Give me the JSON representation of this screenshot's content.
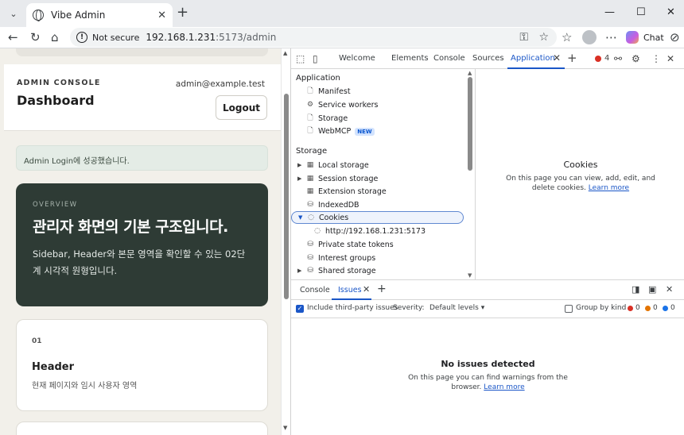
{
  "browser": {
    "tab_title": "Vibe Admin",
    "not_secure": "Not secure",
    "url_host": "192.168.1.231",
    "url_path": ":5173/admin",
    "chat_label": "Chat"
  },
  "page": {
    "kicker": "ADMIN CONSOLE",
    "title": "Dashboard",
    "email": "admin@example.test",
    "logout": "Logout",
    "alert": "Admin Login에 성공했습니다.",
    "overview": {
      "kicker": "OVERVIEW",
      "heading": "관리자 화면의 기본 구조입니다.",
      "desc_line1": "Sidebar, Header와 본문 영역을 확인할 수 있는 02단",
      "desc_line2": "계 시각적 원형입니다."
    },
    "feature": {
      "num": "01",
      "title": "Header",
      "desc": "현재 페이지와 임시 사용자 영역"
    }
  },
  "devtools": {
    "tabs": [
      "Welcome",
      "Elements",
      "Console",
      "Sources",
      "Application"
    ],
    "error_count": "4",
    "sections": {
      "application": "Application",
      "storage": "Storage"
    },
    "application_items": [
      "Manifest",
      "Service workers",
      "Storage",
      "WebMCP"
    ],
    "new_badge": "NEW",
    "storage_items": [
      "Local storage",
      "Session storage",
      "Extension storage",
      "IndexedDB",
      "Cookies",
      "http://192.168.1.231:5173",
      "Private state tokens",
      "Interest groups",
      "Shared storage"
    ],
    "cookies_title": "Cookies",
    "cookies_desc": "On this page you can view, add, edit, and delete cookies.",
    "learn_more": "Learn more",
    "drawer_tabs": [
      "Console",
      "Issues"
    ],
    "filter": {
      "third_party": "Include third-party issues",
      "severity": "Severity:",
      "levels": "Default levels ▾",
      "group": "Group by kind",
      "counts": [
        "0",
        "0",
        "0"
      ]
    },
    "no_issues_title": "No issues detected",
    "no_issues_desc": "On this page you can find warnings from the browser.",
    "colors": {
      "accent": "#1a56c7",
      "error": "#d93025",
      "warning": "#e37400",
      "info": "#1a73e8"
    }
  }
}
